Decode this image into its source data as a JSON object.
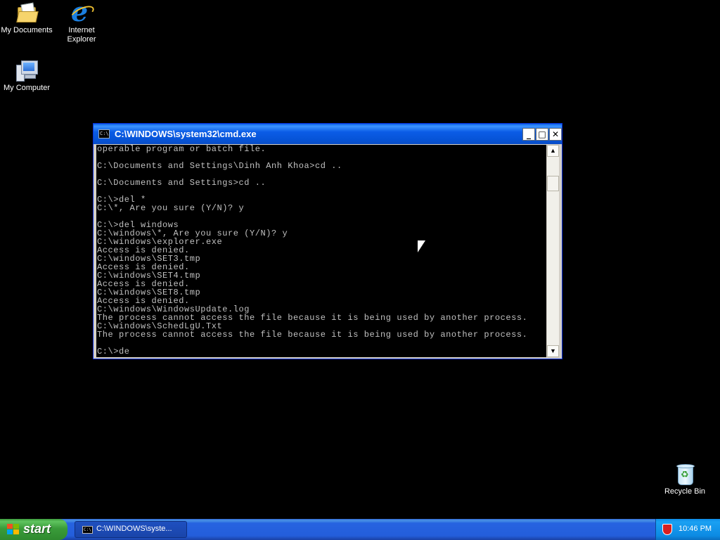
{
  "desktop": {
    "icons": [
      {
        "label": "My Documents",
        "icon": "folder-documents-icon"
      },
      {
        "label": "Internet Explorer",
        "icon": "internet-explorer-icon"
      },
      {
        "label": "My Computer",
        "icon": "computer-icon"
      },
      {
        "label": "Recycle Bin",
        "icon": "recycle-bin-icon"
      }
    ]
  },
  "cmd_window": {
    "title": "C:\\WINDOWS\\system32\\cmd.exe",
    "controls": {
      "minimize": "minimize-icon",
      "maximize": "maximize-icon",
      "close": "close-icon"
    },
    "console_lines": [
      "operable program or batch file.",
      "",
      "C:\\Documents and Settings\\Dinh Anh Khoa>cd ..",
      "",
      "C:\\Documents and Settings>cd ..",
      "",
      "C:\\>del *",
      "C:\\*, Are you sure (Y/N)? y",
      "",
      "C:\\>del windows",
      "C:\\windows\\*, Are you sure (Y/N)? y",
      "C:\\windows\\explorer.exe",
      "Access is denied.",
      "C:\\windows\\SET3.tmp",
      "Access is denied.",
      "C:\\windows\\SET4.tmp",
      "Access is denied.",
      "C:\\windows\\SET8.tmp",
      "Access is denied.",
      "C:\\windows\\WindowsUpdate.log",
      "The process cannot access the file because it is being used by another process.",
      "C:\\windows\\SchedLgU.Txt",
      "The process cannot access the file because it is being used by another process.",
      "",
      "C:\\>de"
    ]
  },
  "taskbar": {
    "start_label": "start",
    "tasks": [
      {
        "label": "C:\\WINDOWS\\syste..."
      }
    ],
    "clock": "10:46 PM"
  },
  "colors": {
    "desktop_bg": "#000000",
    "titlebar": "#0b5ce6",
    "taskbar": "#245edb",
    "start_green": "#3a9b3a",
    "tray": "#0f8de8",
    "console_text": "#c0c0c0"
  }
}
